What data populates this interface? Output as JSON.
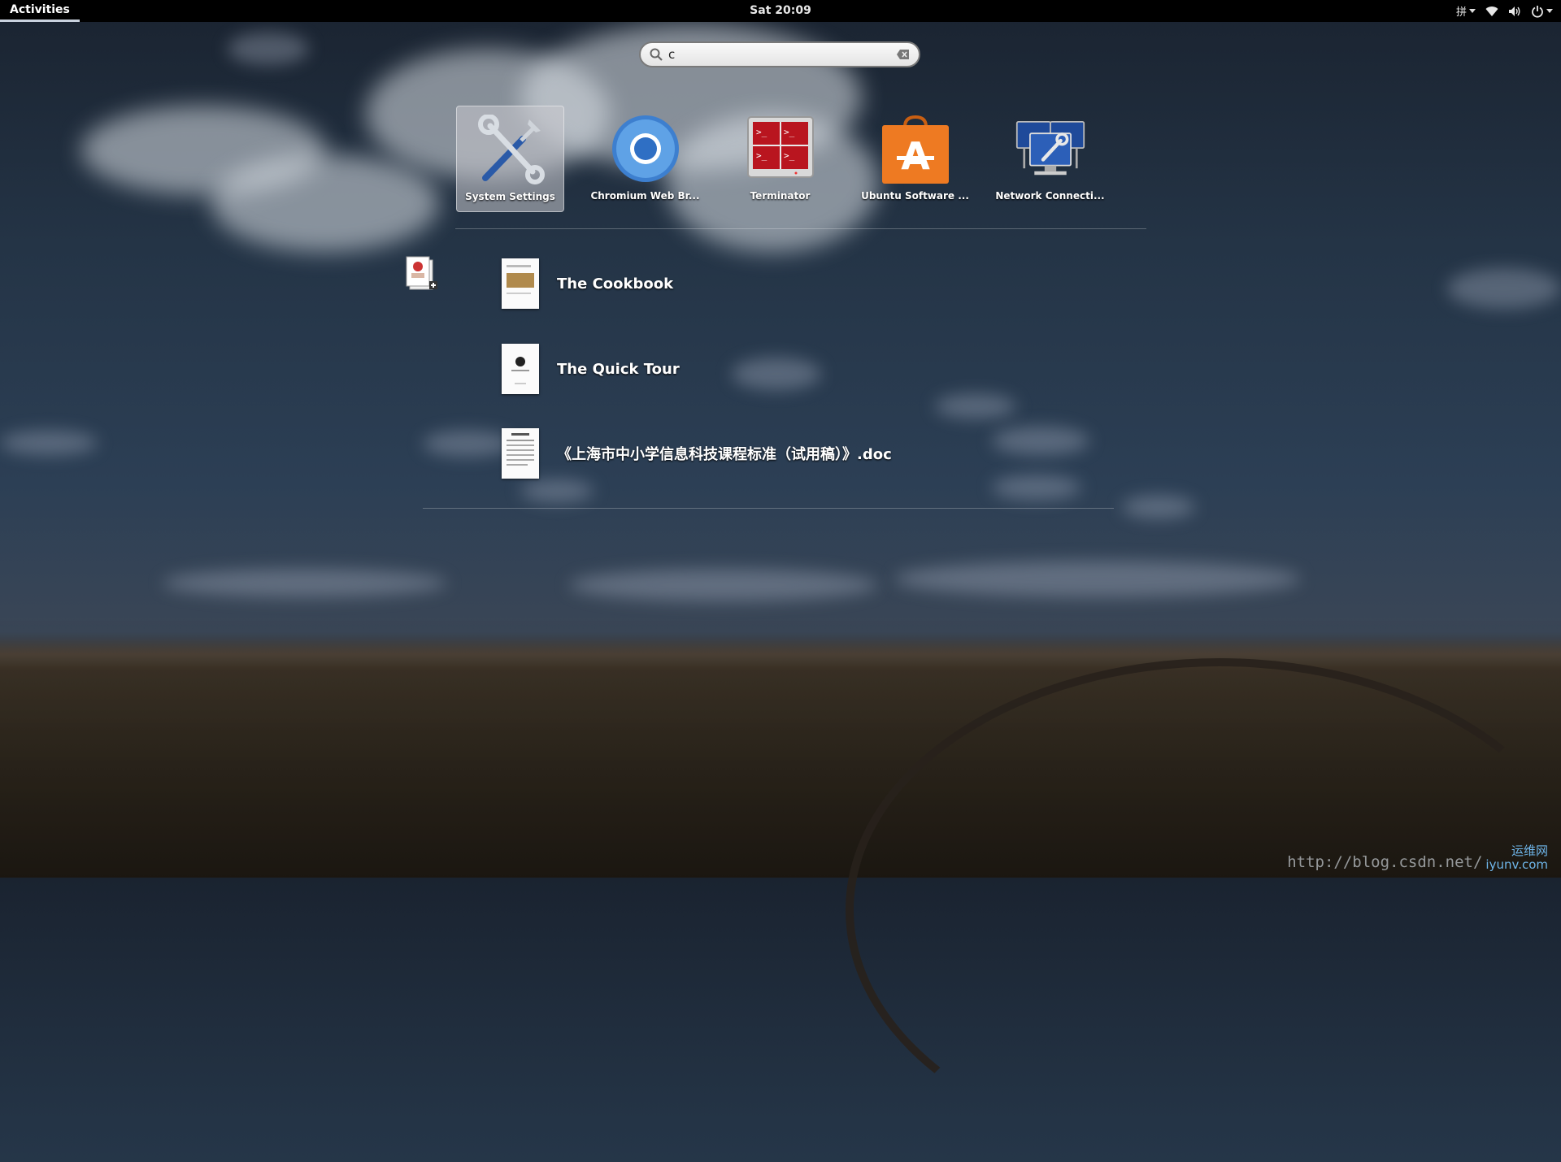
{
  "topbar": {
    "activities_label": "Activities",
    "clock": "Sat 20:09",
    "input_method": "拼",
    "icons": [
      "input-method-icon",
      "wifi-icon",
      "volume-icon",
      "power-icon"
    ]
  },
  "search": {
    "value": "c",
    "placeholder": ""
  },
  "apps": [
    {
      "label": "System Settings",
      "icon": "system-settings-icon",
      "selected": true
    },
    {
      "label": "Chromium Web Br...",
      "icon": "chromium-icon",
      "selected": false
    },
    {
      "label": "Terminator",
      "icon": "terminator-icon",
      "selected": false
    },
    {
      "label": "Ubuntu Software ...",
      "icon": "ubuntu-software-icon",
      "selected": false
    },
    {
      "label": "Network Connecti...",
      "icon": "network-connections-icon",
      "selected": false
    }
  ],
  "documents": [
    {
      "title": "The Cookbook"
    },
    {
      "title": "The Quick Tour"
    },
    {
      "title": "《上海市中小学信息科技课程标准（试用稿）》.doc"
    }
  ],
  "watermark": {
    "url": "http://blog.csdn.net/",
    "logo_cn": "运维网",
    "logo_en": "iyunv.com"
  },
  "colors": {
    "terminator_red": "#c8202a",
    "software_orange": "#ee7a22",
    "chromium_blue": "#4a8fd8"
  }
}
